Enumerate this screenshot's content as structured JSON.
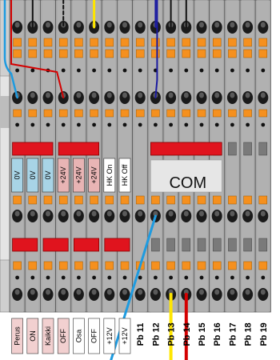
{
  "colors": {
    "terminal_gray": "#a9a9a9",
    "terminal_dark": "#8a8a8a",
    "orange": "#f5901e",
    "red": "#e0141e",
    "blue_label": "#a8d4e6",
    "pink_label": "#e8b4b4",
    "wire_black": "#111111",
    "wire_yellow": "#ffe600",
    "wire_blue": "#1e9be0",
    "wire_navy": "#1a1aa0",
    "wire_red": "#d40000"
  },
  "terminal_labels": [
    {
      "text": "0V",
      "color": "blue"
    },
    {
      "text": "0V",
      "color": "blue"
    },
    {
      "text": "0V",
      "color": "blue"
    },
    {
      "text": "+24V",
      "color": "pink"
    },
    {
      "text": "+24V",
      "color": "pink"
    },
    {
      "text": "+24V",
      "color": "pink"
    },
    {
      "text": "HK On",
      "color": "white"
    },
    {
      "text": "HK Off",
      "color": "white"
    }
  ],
  "com_label": "COM",
  "bottom_labels": [
    {
      "text": "Perus",
      "bg": "pink"
    },
    {
      "text": "ON",
      "bg": "pink"
    },
    {
      "text": "Kaikki",
      "bg": "pink"
    },
    {
      "text": "OFF",
      "bg": "pink"
    },
    {
      "text": "Osa",
      "bg": "white"
    },
    {
      "text": "OFF",
      "bg": "white"
    },
    {
      "text": "+12V",
      "bg": "white"
    },
    {
      "text": "+12V",
      "bg": "white"
    }
  ],
  "pb_labels": [
    "Pb 11",
    "Pb 12",
    "Pb 13",
    "Pb 14",
    "Pb 15",
    "Pb 16",
    "Pb 17",
    "Pb 18",
    "Pb 19"
  ]
}
